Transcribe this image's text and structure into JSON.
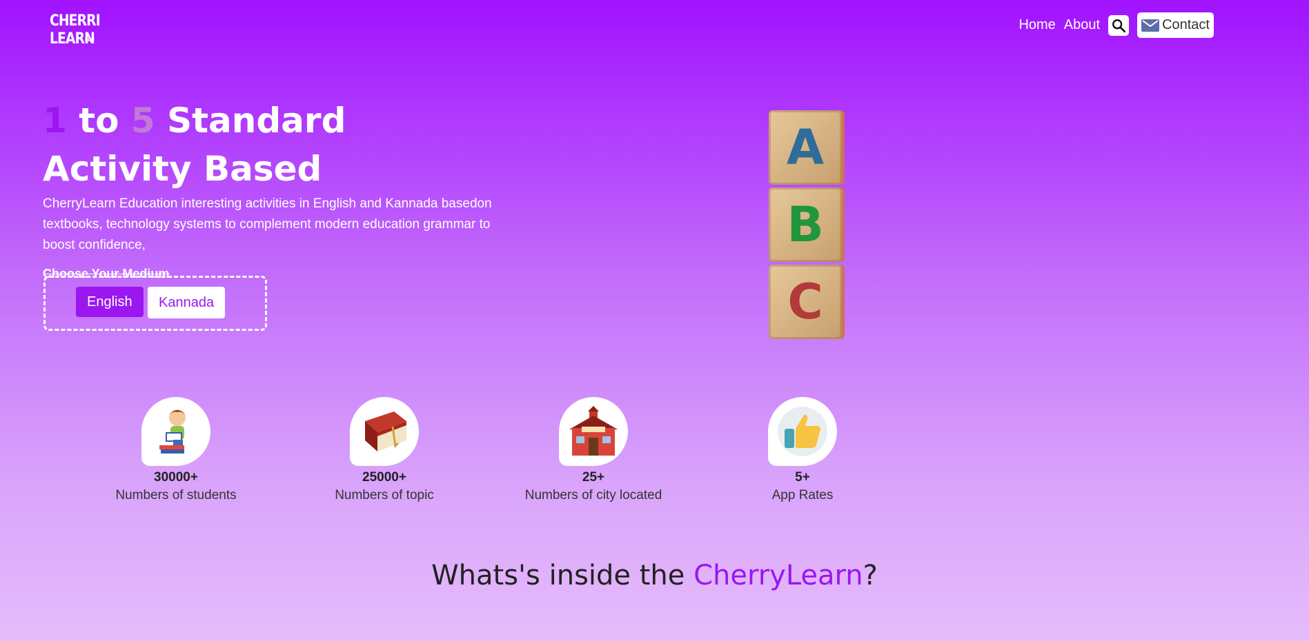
{
  "nav": {
    "logo_line1": "CHERRI",
    "logo_line2": "LEARN",
    "logo_small": "EDU",
    "links": [
      "Home",
      "About"
    ],
    "contact_label": "Contact"
  },
  "hero": {
    "title_num1": "1",
    "title_to": "to",
    "title_num2": "5",
    "title_standard": "Standard",
    "title_line2": "Activity Based",
    "description": "CherryLearn Education interesting activities in English and Kannada basedon textbooks, technology systems to complement modern education grammar to boost confidence,",
    "medium_label": "Choose Your Medium",
    "medium_options": [
      "English",
      "Kannada"
    ],
    "blocks": [
      "A",
      "B",
      "C"
    ]
  },
  "stats": [
    {
      "value": "30000+",
      "label": "Numbers of students",
      "icon": "student-reading-icon"
    },
    {
      "value": "25000+",
      "label": "Numbers of topic",
      "icon": "book-icon"
    },
    {
      "value": "25+",
      "label": "Numbers of city located",
      "icon": "school-icon"
    },
    {
      "value": "5+",
      "label": "App Rates",
      "icon": "thumbs-up-icon"
    }
  ],
  "section": {
    "title_prefix": "Whats's inside the ",
    "title_brand": "CherryLearn",
    "title_suffix": "?"
  },
  "colors": {
    "accent": "#9b16ef",
    "bg_top": "#a112ff",
    "bg_bottom": "#e6bcfb"
  }
}
